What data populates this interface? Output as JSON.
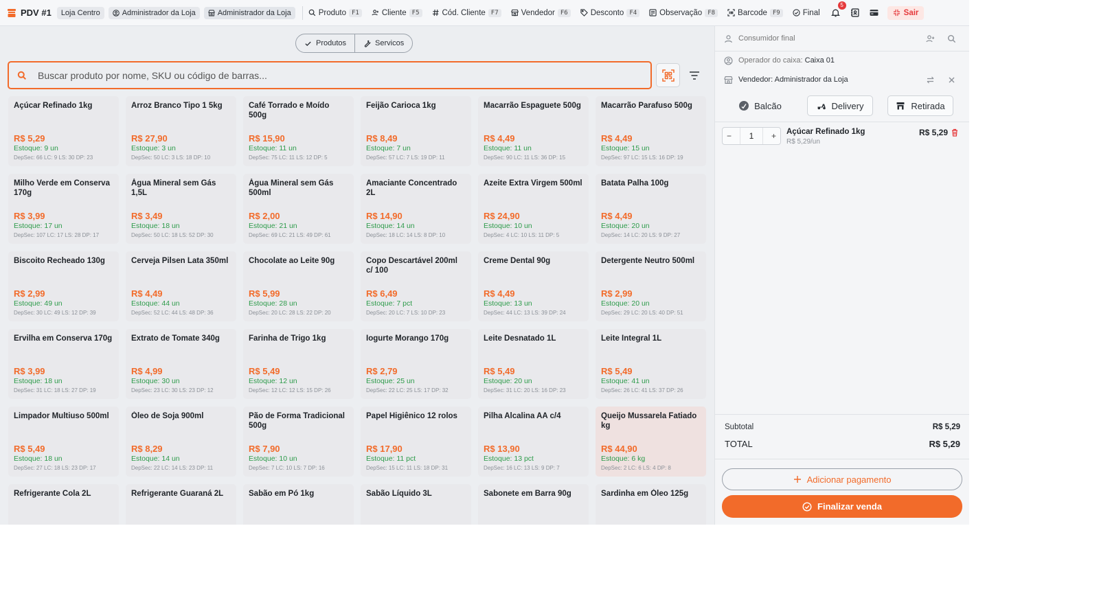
{
  "topbar": {
    "pdv_label": "PDV #1",
    "store_label": "Loja Centro",
    "role_chip_1": "Administrador da Loja",
    "role_chip_2": "Administrador da Loja",
    "nav": [
      {
        "icon": "search-icon",
        "label": "Produto",
        "key": "F1"
      },
      {
        "icon": "add-user-icon",
        "label": "Cliente",
        "key": "F5"
      },
      {
        "icon": "hash-icon",
        "label": "Cód. Cliente",
        "key": "F7"
      },
      {
        "icon": "store-icon",
        "label": "Vendedor",
        "key": "F6"
      },
      {
        "icon": "tag-icon",
        "label": "Desconto",
        "key": "F4"
      },
      {
        "icon": "note-icon",
        "label": "Observação",
        "key": "F8"
      },
      {
        "icon": "barcode-scan-icon",
        "label": "Barcode",
        "key": "F9"
      },
      {
        "icon": "check-circle-icon",
        "label": "Final",
        "key": ""
      }
    ],
    "notification_count": "5",
    "exit_label": "Sair"
  },
  "toggle": {
    "products_label": "Produtos",
    "services_label": "Servicos"
  },
  "search": {
    "placeholder": "Buscar produto por nome, SKU ou código de barras..."
  },
  "products": [
    {
      "name": "Açúcar Refinado 1kg",
      "price": "R$ 5,29",
      "stock": "Estoque: 9 un",
      "deps": "DepSec: 66  LC: 9  LS: 30  DP: 23"
    },
    {
      "name": "Arroz Branco Tipo 1 5kg",
      "price": "R$ 27,90",
      "stock": "Estoque: 3 un",
      "deps": "DepSec: 50  LC: 3  LS: 18  DP: 10"
    },
    {
      "name": "Café Torrado e Moído 500g",
      "price": "R$ 15,90",
      "stock": "Estoque: 11 un",
      "deps": "DepSec: 75  LC: 11  LS: 12  DP: 5"
    },
    {
      "name": "Feijão Carioca 1kg",
      "price": "R$ 8,49",
      "stock": "Estoque: 7 un",
      "deps": "DepSec: 57  LC: 7  LS: 19  DP: 11"
    },
    {
      "name": "Macarrão Espaguete 500g",
      "price": "R$ 4,49",
      "stock": "Estoque: 11 un",
      "deps": "DepSec: 90  LC: 11  LS: 36  DP: 15"
    },
    {
      "name": "Macarrão Parafuso 500g",
      "price": "R$ 4,49",
      "stock": "Estoque: 15 un",
      "deps": "DepSec: 97  LC: 15  LS: 16  DP: 19"
    },
    {
      "name": "Milho Verde em Conserva 170g",
      "price": "R$ 3,99",
      "stock": "Estoque: 17 un",
      "deps": "DepSec: 107  LC: 17  LS: 28  DP: 17"
    },
    {
      "name": "Água Mineral sem Gás 1,5L",
      "price": "R$ 3,49",
      "stock": "Estoque: 18 un",
      "deps": "DepSec: 50  LC: 18  LS: 52  DP: 30"
    },
    {
      "name": "Água Mineral sem Gás 500ml",
      "price": "R$ 2,00",
      "stock": "Estoque: 21 un",
      "deps": "DepSec: 69  LC: 21  LS: 49  DP: 61"
    },
    {
      "name": "Amaciante Concentrado 2L",
      "price": "R$ 14,90",
      "stock": "Estoque: 14 un",
      "deps": "DepSec: 18  LC: 14  LS: 8  DP: 10"
    },
    {
      "name": "Azeite Extra Virgem 500ml",
      "price": "R$ 24,90",
      "stock": "Estoque: 10 un",
      "deps": "DepSec: 4  LC: 10  LS: 11  DP: 5"
    },
    {
      "name": "Batata Palha 100g",
      "price": "R$ 4,49",
      "stock": "Estoque: 20 un",
      "deps": "DepSec: 14  LC: 20  LS: 9  DP: 27"
    },
    {
      "name": "Biscoito Recheado 130g",
      "price": "R$ 2,99",
      "stock": "Estoque: 49 un",
      "deps": "DepSec: 30  LC: 49  LS: 12  DP: 39"
    },
    {
      "name": "Cerveja Pilsen Lata 350ml",
      "price": "R$ 4,49",
      "stock": "Estoque: 44 un",
      "deps": "DepSec: 52  LC: 44  LS: 48  DP: 36"
    },
    {
      "name": "Chocolate ao Leite 90g",
      "price": "R$ 5,99",
      "stock": "Estoque: 28 un",
      "deps": "DepSec: 20  LC: 28  LS: 22  DP: 20"
    },
    {
      "name": "Copo Descartável 200ml c/ 100",
      "price": "R$ 6,49",
      "stock": "Estoque: 7 pct",
      "deps": "DepSec: 20  LC: 7  LS: 10  DP: 23"
    },
    {
      "name": "Creme Dental 90g",
      "price": "R$ 4,49",
      "stock": "Estoque: 13 un",
      "deps": "DepSec: 44  LC: 13  LS: 39  DP: 24"
    },
    {
      "name": "Detergente Neutro 500ml",
      "price": "R$ 2,99",
      "stock": "Estoque: 20 un",
      "deps": "DepSec: 29  LC: 20  LS: 40  DP: 51"
    },
    {
      "name": "Ervilha em Conserva 170g",
      "price": "R$ 3,99",
      "stock": "Estoque: 18 un",
      "deps": "DepSec: 31  LC: 18  LS: 27  DP: 19"
    },
    {
      "name": "Extrato de Tomate 340g",
      "price": "R$ 4,99",
      "stock": "Estoque: 30 un",
      "deps": "DepSec: 23  LC: 30  LS: 23  DP: 12"
    },
    {
      "name": "Farinha de Trigo 1kg",
      "price": "R$ 5,49",
      "stock": "Estoque: 12 un",
      "deps": "DepSec: 12  LC: 12  LS: 15  DP: 26"
    },
    {
      "name": "Iogurte Morango 170g",
      "price": "R$ 2,79",
      "stock": "Estoque: 25 un",
      "deps": "DepSec: 22  LC: 25  LS: 17  DP: 32"
    },
    {
      "name": "Leite Desnatado 1L",
      "price": "R$ 5,49",
      "stock": "Estoque: 20 un",
      "deps": "DepSec: 31  LC: 20  LS: 16  DP: 23"
    },
    {
      "name": "Leite Integral 1L",
      "price": "R$ 5,49",
      "stock": "Estoque: 41 un",
      "deps": "DepSec: 26  LC: 41  LS: 37  DP: 26"
    },
    {
      "name": "Limpador Multiuso 500ml",
      "price": "R$ 5,49",
      "stock": "Estoque: 18 un",
      "deps": "DepSec: 27  LC: 18  LS: 23  DP: 17"
    },
    {
      "name": "Óleo de Soja 900ml",
      "price": "R$ 8,29",
      "stock": "Estoque: 14 un",
      "deps": "DepSec: 22  LC: 14  LS: 23  DP: 11"
    },
    {
      "name": "Pão de Forma Tradicional 500g",
      "price": "R$ 7,90",
      "stock": "Estoque: 10 un",
      "deps": "DepSec: 7  LC: 10  LS: 7  DP: 16"
    },
    {
      "name": "Papel Higiênico 12 rolos",
      "price": "R$ 17,90",
      "stock": "Estoque: 11 pct",
      "deps": "DepSec: 15  LC: 11  LS: 18  DP: 31"
    },
    {
      "name": "Pilha Alcalina AA c/4",
      "price": "R$ 13,90",
      "stock": "Estoque: 13 pct",
      "deps": "DepSec: 16  LC: 13  LS: 9  DP: 7"
    },
    {
      "name": "Queijo Mussarela Fatiado kg",
      "price": "R$ 44,90",
      "stock": "Estoque: 6 kg",
      "deps": "DepSec: 2  LC: 6  LS: 4  DP: 8",
      "highlighted": true
    },
    {
      "name": "Refrigerante Cola 2L",
      "price": "",
      "stock": "",
      "deps": ""
    },
    {
      "name": "Refrigerante Guaraná 2L",
      "price": "",
      "stock": "",
      "deps": ""
    },
    {
      "name": "Sabão em Pó 1kg",
      "price": "",
      "stock": "",
      "deps": ""
    },
    {
      "name": "Sabão Líquido 3L",
      "price": "",
      "stock": "",
      "deps": ""
    },
    {
      "name": "Sabonete em Barra 90g",
      "price": "",
      "stock": "",
      "deps": ""
    },
    {
      "name": "Sardinha em Óleo 125g",
      "price": "",
      "stock": "",
      "deps": ""
    }
  ],
  "panel": {
    "customer_label": "Consumidor final",
    "operator_prefix": "Operador do caixa:",
    "operator_value": "Caixa 01",
    "seller_label": "Vendedor: Administrador da Loja",
    "modes": {
      "counter": "Balcão",
      "delivery": "Delivery",
      "pickup": "Retirada"
    },
    "cart": [
      {
        "qty": "1",
        "name": "Açúcar Refinado 1kg",
        "unit": "R$ 5,29/un",
        "total": "R$ 5,29"
      }
    ],
    "subtotal_label": "Subtotal",
    "subtotal_value": "R$ 5,29",
    "total_label": "TOTAL",
    "total_value": "R$ 5,29",
    "add_payment_label": "Adicionar pagamento",
    "finish_label": "Finalizar venda"
  },
  "colors": {
    "accent": "#f26b2a",
    "stock_green": "#2d9b4a",
    "danger": "#e5393b"
  }
}
